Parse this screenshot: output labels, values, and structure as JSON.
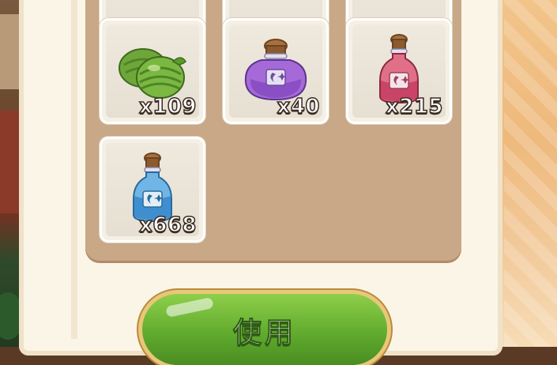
{
  "inventory": {
    "items": [
      {
        "name": "melon",
        "count": "x109",
        "icon": "melon-icon"
      },
      {
        "name": "purple-potion",
        "count": "x40",
        "icon": "purple-potion-icon"
      },
      {
        "name": "red-potion",
        "count": "x215",
        "icon": "red-potion-icon"
      },
      {
        "name": "blue-potion",
        "count": "x668",
        "icon": "blue-potion-icon"
      }
    ]
  },
  "actions": {
    "use_label": "使用"
  },
  "colors": {
    "panel": "#c9a887",
    "slot": "#f5f0e6",
    "button": "#5ea82c",
    "button_rim": "#e9c77a"
  }
}
